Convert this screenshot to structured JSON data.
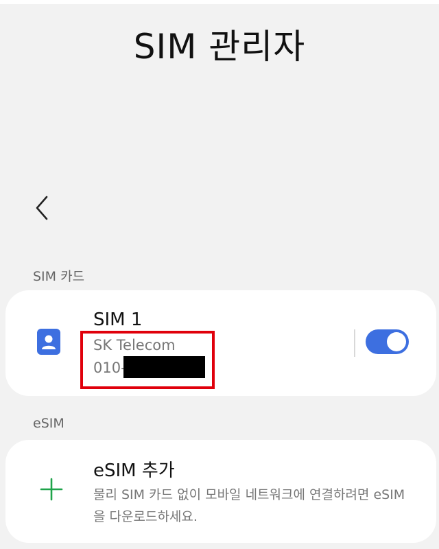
{
  "page": {
    "title": "SIM 관리자"
  },
  "nav": {
    "back_icon": "chevron-left-icon"
  },
  "sim_section": {
    "header": "SIM 카드",
    "sim1": {
      "icon": "contact-card-icon",
      "name": "SIM 1",
      "carrier": "SK Telecom",
      "number_prefix": "010-",
      "enabled": true,
      "accent_color": "#3d6fe0"
    }
  },
  "esim_section": {
    "header": "eSIM",
    "add": {
      "icon": "plus-icon",
      "title": "eSIM 추가",
      "description": "물리 SIM 카드 없이 모바일 네트워크에 연결하려면 eSIM을 다운로드하세요."
    }
  },
  "annotation": {
    "highlight_color": "#e0000b"
  }
}
